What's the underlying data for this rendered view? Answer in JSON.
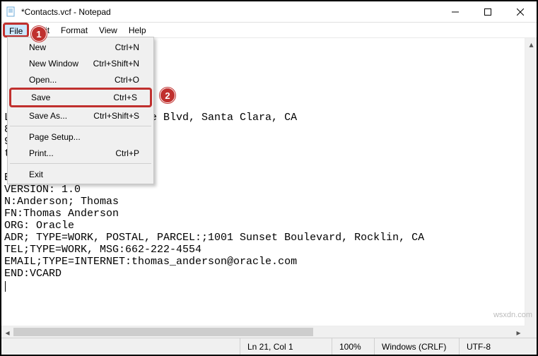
{
  "title": "*Contacts.vcf - Notepad",
  "menubar": {
    "file": "File",
    "edit": "Edit",
    "format": "Format",
    "view": "View",
    "help": "Help"
  },
  "fileMenu": {
    "new": {
      "label": "New",
      "accel": "Ctrl+N"
    },
    "newWindow": {
      "label": "New Window",
      "accel": "Ctrl+Shift+N"
    },
    "open": {
      "label": "Open...",
      "accel": "Ctrl+O"
    },
    "save": {
      "label": "Save",
      "accel": "Ctrl+S"
    },
    "saveAs": {
      "label": "Save As...",
      "accel": "Ctrl+Shift+S"
    },
    "pageSetup": {
      "label": "Page Setup...",
      "accel": ""
    },
    "print": {
      "label": "Print...",
      "accel": "Ctrl+P"
    },
    "exit": {
      "label": "Exit",
      "accel": ""
    }
  },
  "callouts": {
    "one": "1",
    "two": "2"
  },
  "editor": {
    "text": "\n\n\n\n\n\nL:;;2200 Mission College Blvd, Santa Clara, CA\n800\n900\nth.aldridge@intel.com\n\nBEGIN:VCARD\nVERSION: 1.0\nN:Anderson; Thomas\nFN:Thomas Anderson\nORG: Oracle\nADR; TYPE=WORK, POSTAL, PARCEL:;1001 Sunset Boulevard, Rocklin, CA\nTEL;TYPE=WORK, MSG:662-222-4554\nEMAIL;TYPE=INTERNET:thomas_anderson@oracle.com\nEND:VCARD"
  },
  "status": {
    "lncol": "Ln 21, Col 1",
    "zoom": "100%",
    "eol": "Windows (CRLF)",
    "enc": "UTF-8"
  },
  "watermark": "wsxdn.com"
}
